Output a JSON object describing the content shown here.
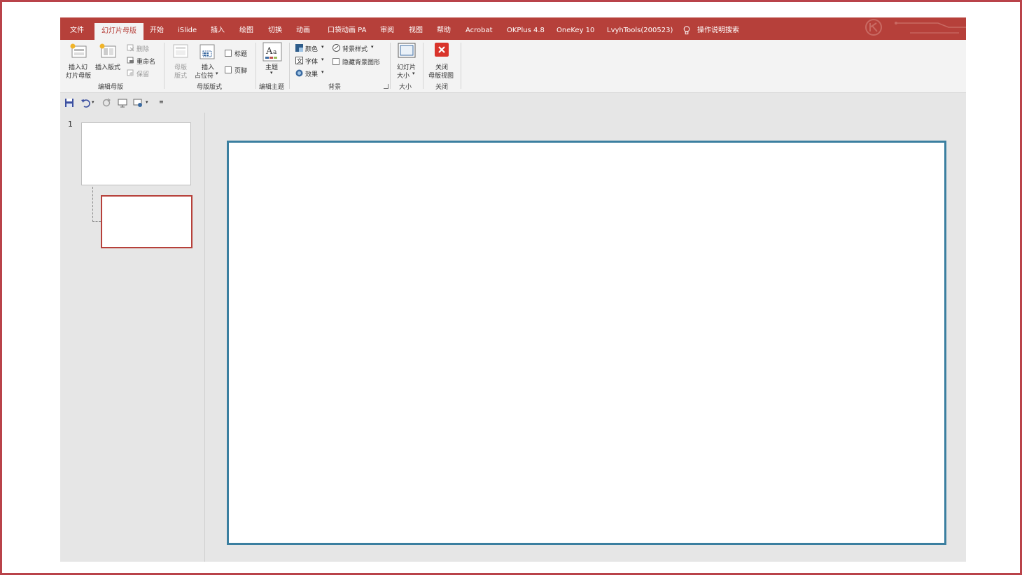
{
  "tabs": [
    {
      "label": "文件",
      "active": false
    },
    {
      "label": "幻灯片母版",
      "active": true
    },
    {
      "label": "开始",
      "active": false
    },
    {
      "label": "iSlide",
      "active": false
    },
    {
      "label": "插入",
      "active": false
    },
    {
      "label": "绘图",
      "active": false
    },
    {
      "label": "切换",
      "active": false
    },
    {
      "label": "动画",
      "active": false
    },
    {
      "label": "口袋动画 PA",
      "active": false
    },
    {
      "label": "审阅",
      "active": false
    },
    {
      "label": "视图",
      "active": false
    },
    {
      "label": "帮助",
      "active": false
    },
    {
      "label": "Acrobat",
      "active": false
    },
    {
      "label": "OKPlus 4.8",
      "active": false
    },
    {
      "label": "OneKey 10",
      "active": false
    },
    {
      "label": "LvyhTools(200523)",
      "active": false
    }
  ],
  "tell_me": "操作说明搜索",
  "ribbon": {
    "edit_master": {
      "insert_master": [
        "插入幻",
        "灯片母版"
      ],
      "insert_layout": "插入版式",
      "delete": "删除",
      "rename": "重命名",
      "preserve": "保留",
      "label": "编辑母版"
    },
    "master_layout": {
      "master_layout_btn": [
        "母版",
        "版式"
      ],
      "insert_placeholder": [
        "插入",
        "占位符"
      ],
      "title_check": "标题",
      "footer_check": "页脚",
      "label": "母版版式"
    },
    "edit_theme": {
      "theme": "主题",
      "label": "编辑主题"
    },
    "background": {
      "colors": "颜色",
      "fonts": "字体",
      "effects": "效果",
      "bg_styles": "背景样式",
      "hide_bg": "隐藏背景图形",
      "label": "背景"
    },
    "size": {
      "slide_size": [
        "幻灯片",
        "大小"
      ],
      "label": "大小"
    },
    "close": {
      "close_view": [
        "关闭",
        "母版视图"
      ],
      "label": "关闭"
    }
  },
  "pane": {
    "slide_number": "1"
  },
  "colors": {
    "accent": "#b6403a",
    "slide_border": "#3b7fa0"
  }
}
